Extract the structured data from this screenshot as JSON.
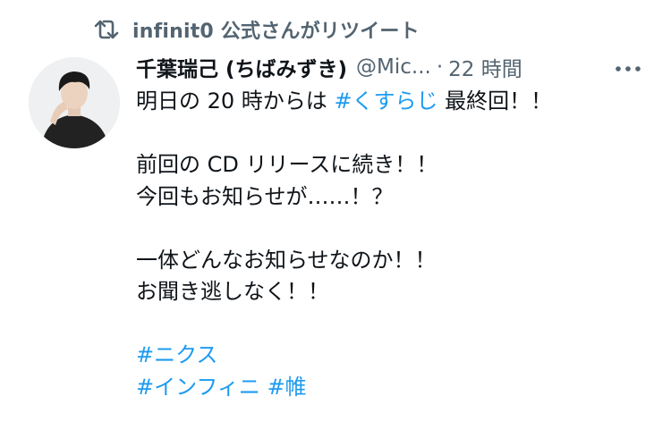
{
  "retweet": {
    "icon": "retweet-icon",
    "label": "infinit0 公式さんがリツイート"
  },
  "author": {
    "name": "千葉瑞己 (ちばみずき)",
    "handle": "@Mic...",
    "separator": "·",
    "time": "22 時間"
  },
  "more_icon": "more-horizontal-icon",
  "tweet": {
    "line1": {
      "text_before": "明日の 20 時からは ",
      "hashtag": "#くすらじ",
      "text_after": " 最終回！！"
    },
    "line3": "前回の CD リリースに続き！！",
    "line4": "今回もお知らせが……！？",
    "line6": "一体どんなお知らせなのか！！",
    "line7": "お聞き逃しなく！！",
    "hashtag1": "#ニクス",
    "hashtag2": "#インフィニ",
    "hashtag3": "#帷"
  },
  "colors": {
    "text": "#0f1419",
    "secondary": "#536471",
    "link": "#1d9bf0"
  }
}
